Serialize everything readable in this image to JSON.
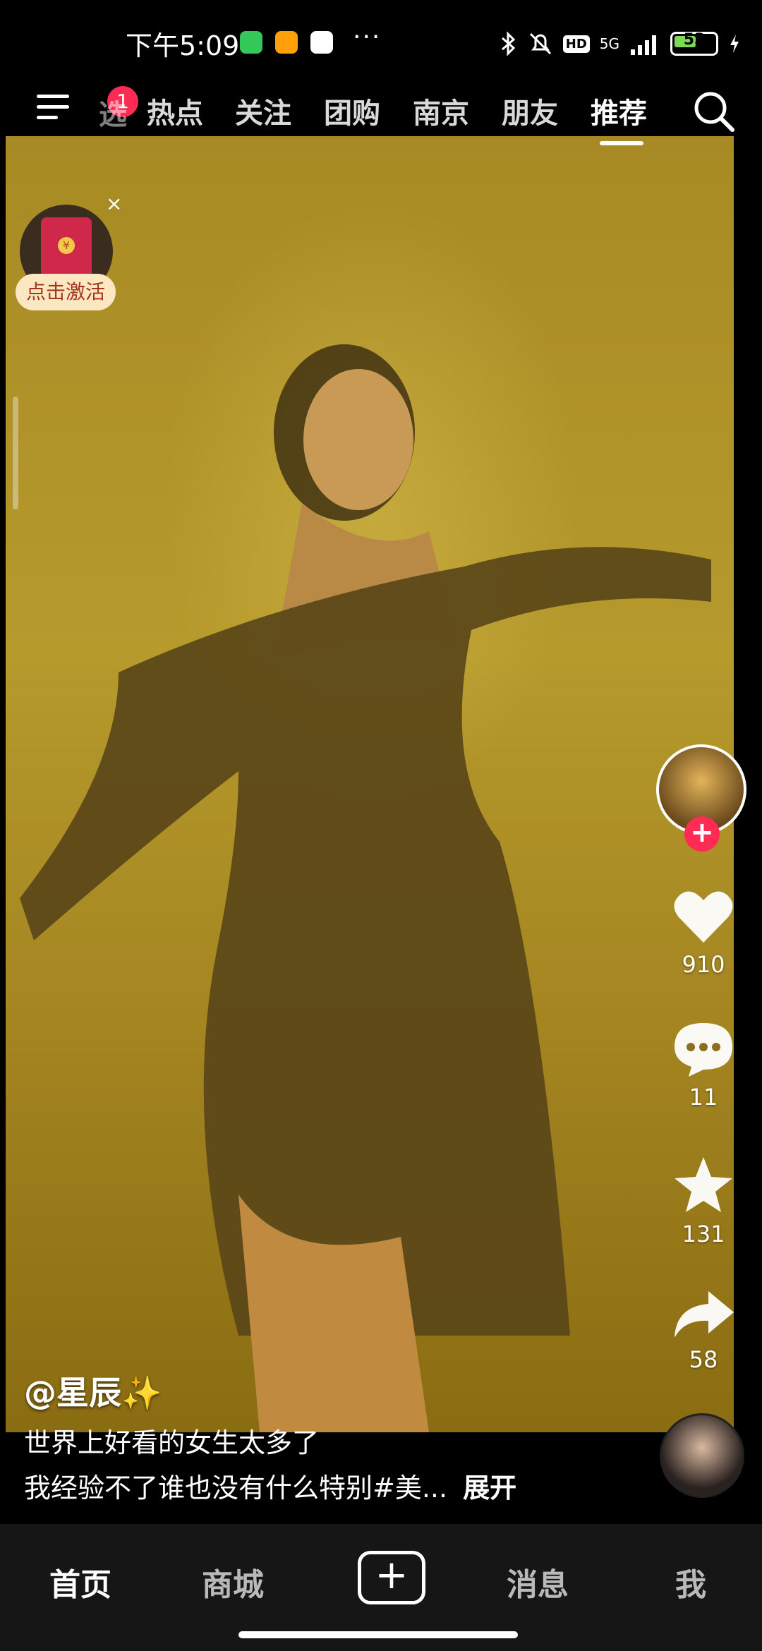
{
  "status_bar": {
    "time": "下午5:09",
    "more": "···",
    "network": "5G",
    "hd": "HD",
    "battery": "53"
  },
  "top_nav": {
    "badge": "1",
    "partial_tab": "选",
    "tabs": [
      "热点",
      "关注",
      "团购",
      "南京",
      "朋友",
      "推荐"
    ],
    "active_tab": "推荐"
  },
  "promo": {
    "label": "点击激活",
    "close": "×",
    "coin": "¥"
  },
  "rail": {
    "follow": "+",
    "likes": "910",
    "comments": "11",
    "favorites": "131",
    "shares": "58"
  },
  "caption": {
    "author": "@星辰✨",
    "line1": "世界上好看的女生太多了",
    "line2": "我经验不了谁也没有什么特别#美...",
    "expand": "展开"
  },
  "bottom_nav": {
    "items": [
      "首页",
      "商城",
      "+",
      "消息",
      "我"
    ],
    "active": "首页"
  },
  "colors": {
    "accent": "#fe2c55",
    "video_bg": "#a88a24"
  }
}
